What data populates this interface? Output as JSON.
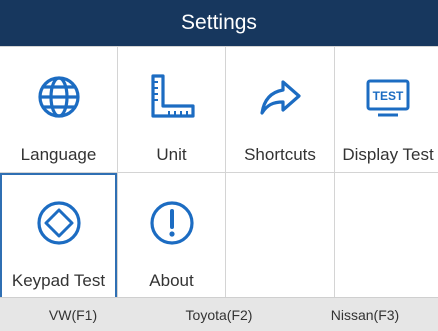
{
  "header": {
    "title": "Settings"
  },
  "tiles": [
    {
      "label": "Language",
      "icon": "globe-icon"
    },
    {
      "label": "Unit",
      "icon": "ruler-icon"
    },
    {
      "label": "Shortcuts",
      "icon": "share-arrow-icon"
    },
    {
      "label": "Display Test",
      "icon": "test-screen-icon",
      "icon_text": "TEST"
    },
    {
      "label": "Keypad Test",
      "icon": "keypad-dpad-icon",
      "selected": true
    },
    {
      "label": "About",
      "icon": "info-exclamation-icon"
    }
  ],
  "function_keys": [
    {
      "label": "VW(F1)"
    },
    {
      "label": "Toyota(F2)"
    },
    {
      "label": "Nissan(F3)"
    }
  ],
  "colors": {
    "header_bg": "#17375e",
    "icon_blue": "#1c6cc2",
    "selection": "#2f6fb3"
  }
}
